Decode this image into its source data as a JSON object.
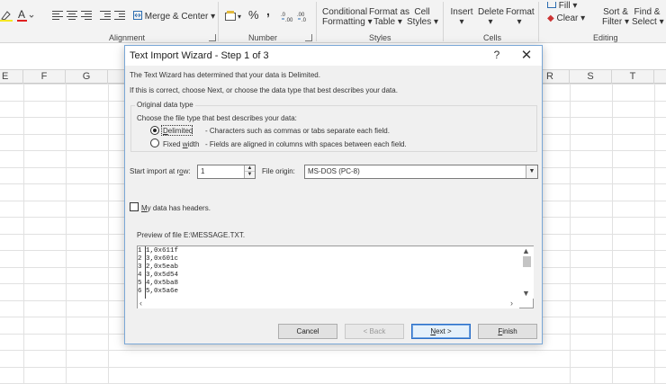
{
  "ribbon": {
    "merge_center": "Merge & Center",
    "conditional_1": "Conditional",
    "conditional_2": "Formatting",
    "format_table_1": "Format as",
    "format_table_2": "Table",
    "cell_styles_1": "Cell",
    "cell_styles_2": "Styles",
    "insert": "Insert",
    "delete": "Delete",
    "format": "Format",
    "fill": "Fill",
    "clear": "Clear",
    "sort_1": "Sort &",
    "sort_2": "Filter",
    "find_1": "Find &",
    "find_2": "Select",
    "percent": "%",
    "comma": ",",
    "group_alignment": "Alignment",
    "group_number": "Number",
    "group_styles": "Styles",
    "group_cells": "Cells",
    "group_editing": "Editing"
  },
  "grid": {
    "columns": [
      "E",
      "F",
      "G",
      "R",
      "S",
      "T"
    ]
  },
  "dialog": {
    "title": "Text Import Wizard - Step 1 of 3",
    "help": "?",
    "intro1": "The Text Wizard has determined that your data is Delimited.",
    "intro2": "If this is correct, choose Next, or choose the data type that best describes your data.",
    "group_title": "Original data type",
    "choose_label": "Choose the file type that best describes your data:",
    "delimited_label": "Delimited",
    "delimited_desc": "- Characters such as commas or tabs separate each field.",
    "fixed_label": "Fixed width",
    "fixed_desc": "- Fields are aligned in columns with spaces between each field.",
    "start_row_label": "Start import at row:",
    "start_row_value": "1",
    "file_origin_label": "File origin:",
    "file_origin_value": "MS-DOS (PC-8)",
    "headers_label": "My data has headers.",
    "preview_label": "Preview of file E:\\MESSAGE.TXT.",
    "preview_lines": [
      {
        "num": "1",
        "text": "1,0x611f"
      },
      {
        "num": "2",
        "text": "3,0x601c"
      },
      {
        "num": "3",
        "text": "2,0x5eab"
      },
      {
        "num": "4",
        "text": "3,0x5d54"
      },
      {
        "num": "5",
        "text": "4,0x5ba8"
      },
      {
        "num": "6",
        "text": "5,0x5a6e"
      }
    ],
    "buttons": {
      "cancel": "Cancel",
      "back": "< Back",
      "next": "Next >",
      "finish": "Finish"
    }
  }
}
